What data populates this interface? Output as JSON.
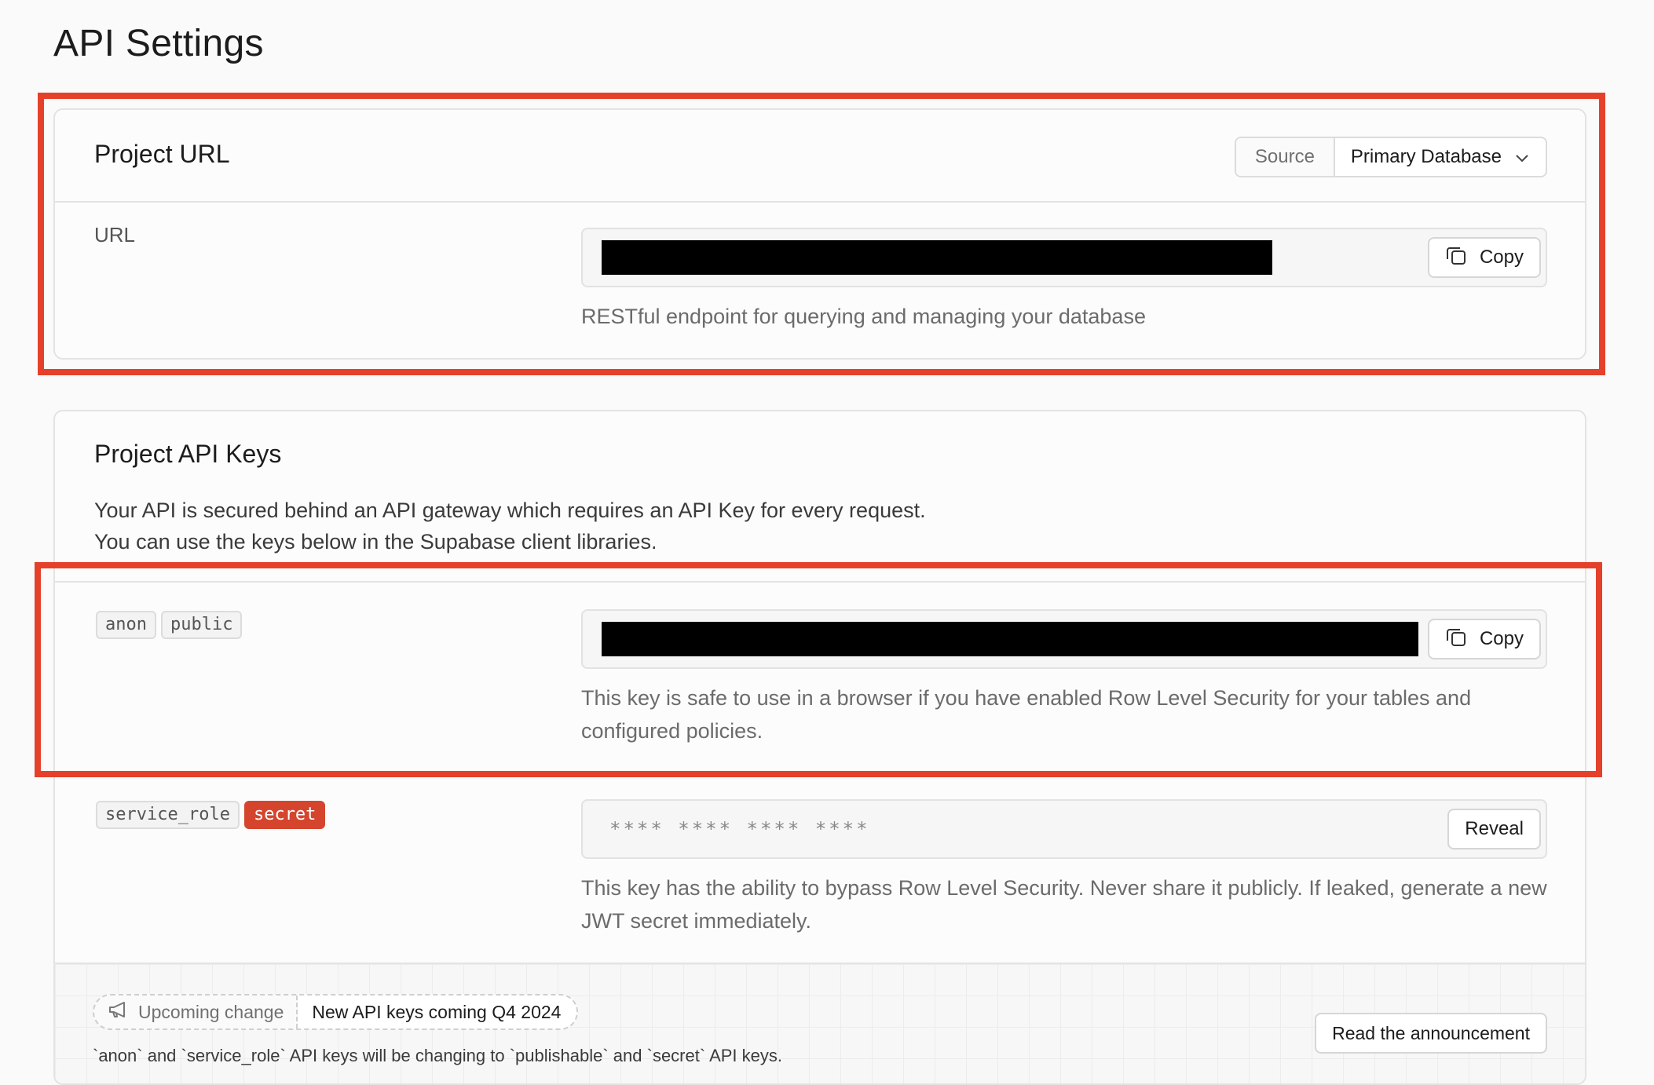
{
  "page": {
    "title": "API Settings"
  },
  "project_url": {
    "title": "Project URL",
    "source": {
      "label": "Source",
      "selected": "Primary Database",
      "icon": "chevron-down-icon"
    },
    "url_row": {
      "label": "URL",
      "value": "",
      "copy_label": "Copy",
      "helper": "RESTful endpoint for querying and managing your database"
    }
  },
  "api_keys": {
    "title": "Project API Keys",
    "intro_line1": "Your API is secured behind an API gateway which requires an API Key for every request.",
    "intro_line2": "You can use the keys below in the Supabase client libraries.",
    "anon": {
      "tags": [
        "anon",
        "public"
      ],
      "copy_label": "Copy",
      "helper": "This key is safe to use in a browser if you have enabled Row Level Security for your tables and configured policies."
    },
    "service_role": {
      "tags": [
        "service_role",
        "secret"
      ],
      "masked_value": "**** **** **** ****",
      "reveal_label": "Reveal",
      "helper": "This key has the ability to bypass Row Level Security. Never share it publicly. If leaked, generate a new JWT secret immediately."
    }
  },
  "footer": {
    "pill_label": "Upcoming change",
    "pill_value": "New API keys coming Q4 2024",
    "note": "`anon` and `service_role` API keys will be changing to `publishable` and `secret` API keys.",
    "button_label": "Read the announcement"
  },
  "colors": {
    "highlight": "#e5402a",
    "secret_tag": "#d5452e"
  }
}
